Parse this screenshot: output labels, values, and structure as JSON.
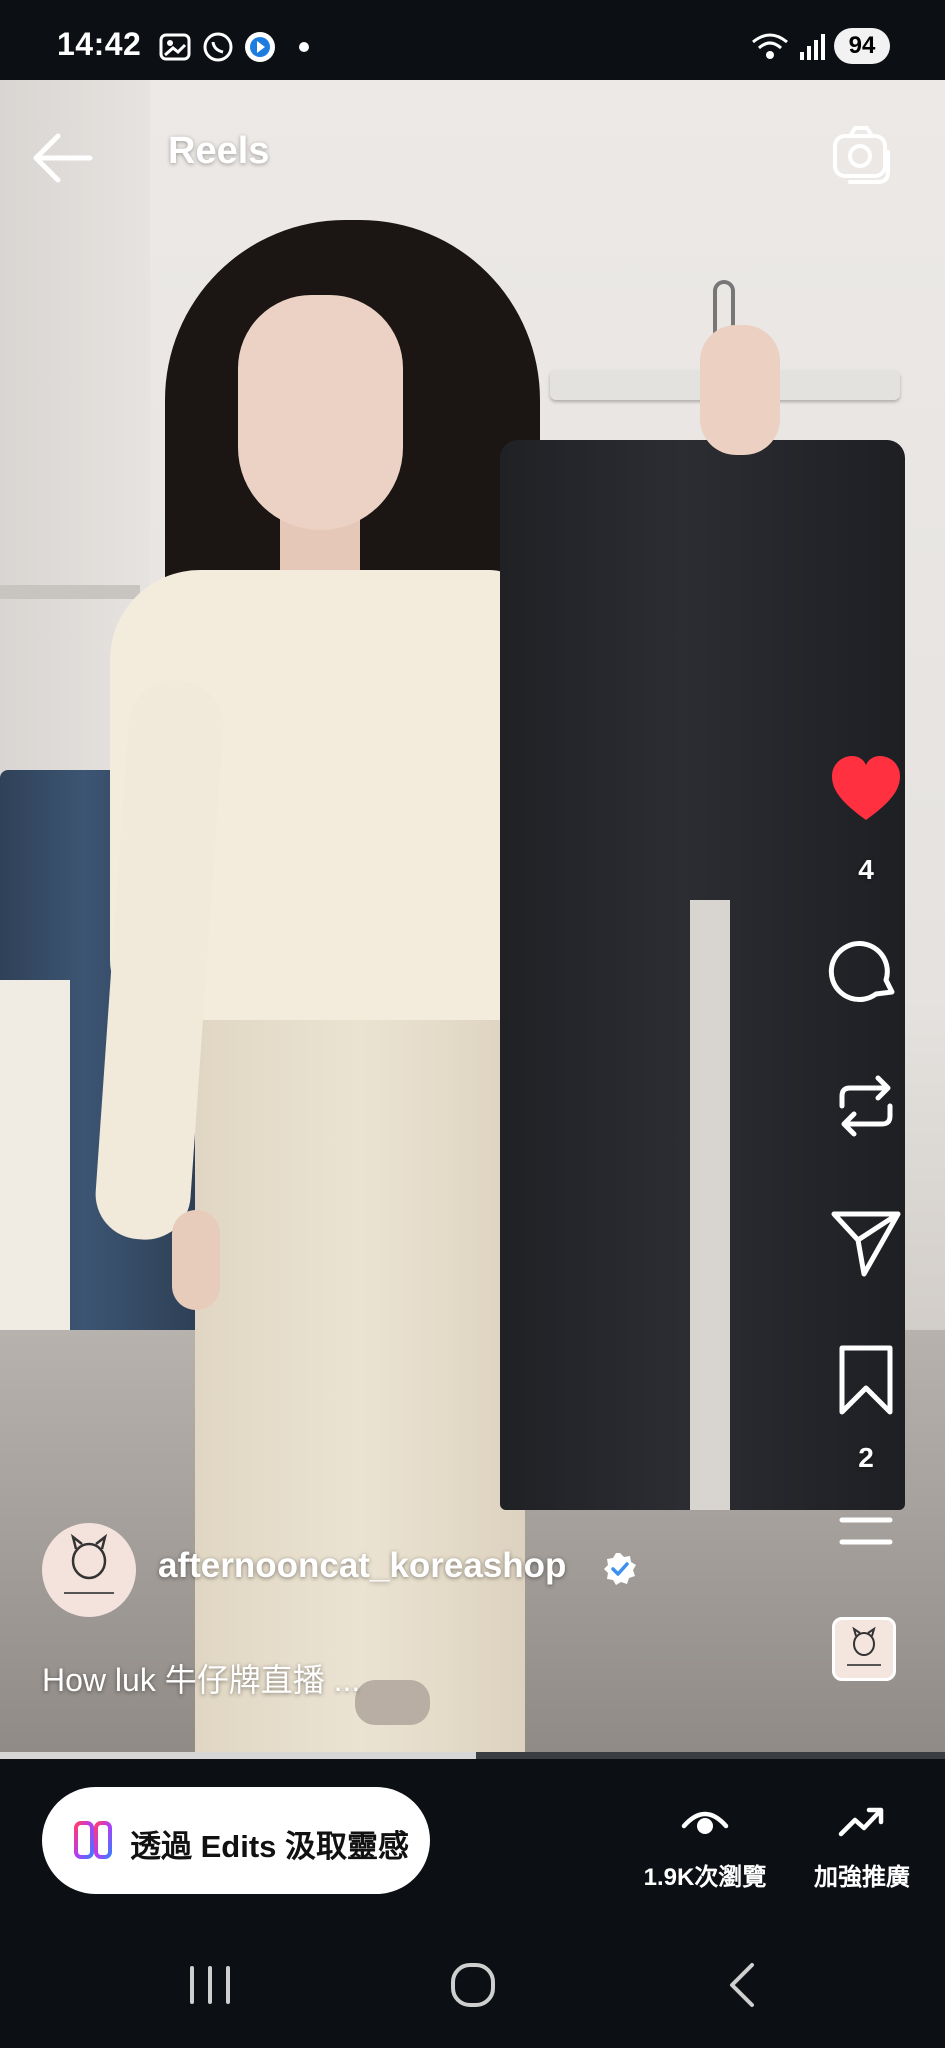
{
  "status_bar": {
    "time": "14:42",
    "battery": "94",
    "icons": [
      "gallery-icon",
      "whatsapp-icon",
      "app-icon",
      "dot-icon",
      "wifi-icon",
      "signal-icon"
    ]
  },
  "header": {
    "title": "Reels",
    "back_icon": "arrow-left-icon",
    "camera_icon": "camera-icon"
  },
  "actions": {
    "like_count": "4",
    "save_count": "2",
    "like_color": "#ff3040"
  },
  "author": {
    "username": "afternooncat_koreashop",
    "verified": true
  },
  "caption": "How luk 牛仔牌直播 ...",
  "playback": {
    "progress": 0.504
  },
  "bottom": {
    "edits_label": "透過 Edits 汲取靈感",
    "views_label": "1.9K次瀏覽",
    "promote_label": "加強推廣"
  },
  "colors": {
    "background": "#0c0f14",
    "accent": "#ff3040"
  }
}
